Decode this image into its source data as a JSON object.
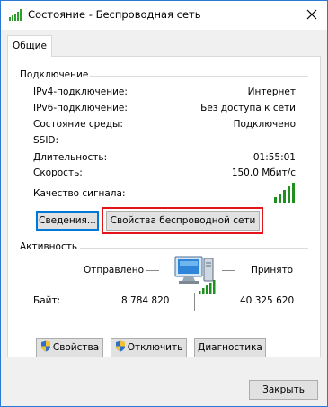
{
  "window": {
    "title": "Состояние - Беспроводная сеть",
    "accent": "#2b79d5"
  },
  "tabs": [
    {
      "label": "Общие",
      "selected": true
    }
  ],
  "connection": {
    "header": "Подключение",
    "rows": [
      {
        "label": "IPv4-подключение:",
        "value": "Интернет"
      },
      {
        "label": "IPv6-подключение:",
        "value": "Без доступа к сети"
      },
      {
        "label": "Состояние среды:",
        "value": "Подключено"
      },
      {
        "label": "SSID:",
        "value": ""
      },
      {
        "label": "Длительность:",
        "value": "01:55:01"
      },
      {
        "label": "Скорость:",
        "value": "150.0 Мбит/с"
      }
    ],
    "signal_label": "Качество сигнала:",
    "signal_bars_filled": 5,
    "signal_bars_total": 5,
    "details_button": "Сведения...",
    "wireless_props_button": "Свойства беспроводной сети"
  },
  "activity": {
    "header": "Активность",
    "sent_label": "Отправлено",
    "received_label": "Принято",
    "bytes_label": "Байт:",
    "bytes_sent": "8 784 820",
    "bytes_received": "40 325 620"
  },
  "actions": {
    "properties_button": "Свойства",
    "disable_button": "Отключить",
    "diagnose_button": "Диагностика"
  },
  "footer": {
    "close_button": "Закрыть"
  },
  "colors": {
    "signal_green": "#1f8f1f",
    "highlight_red": "#e3141a",
    "default_button_blue": "#0078d7"
  }
}
